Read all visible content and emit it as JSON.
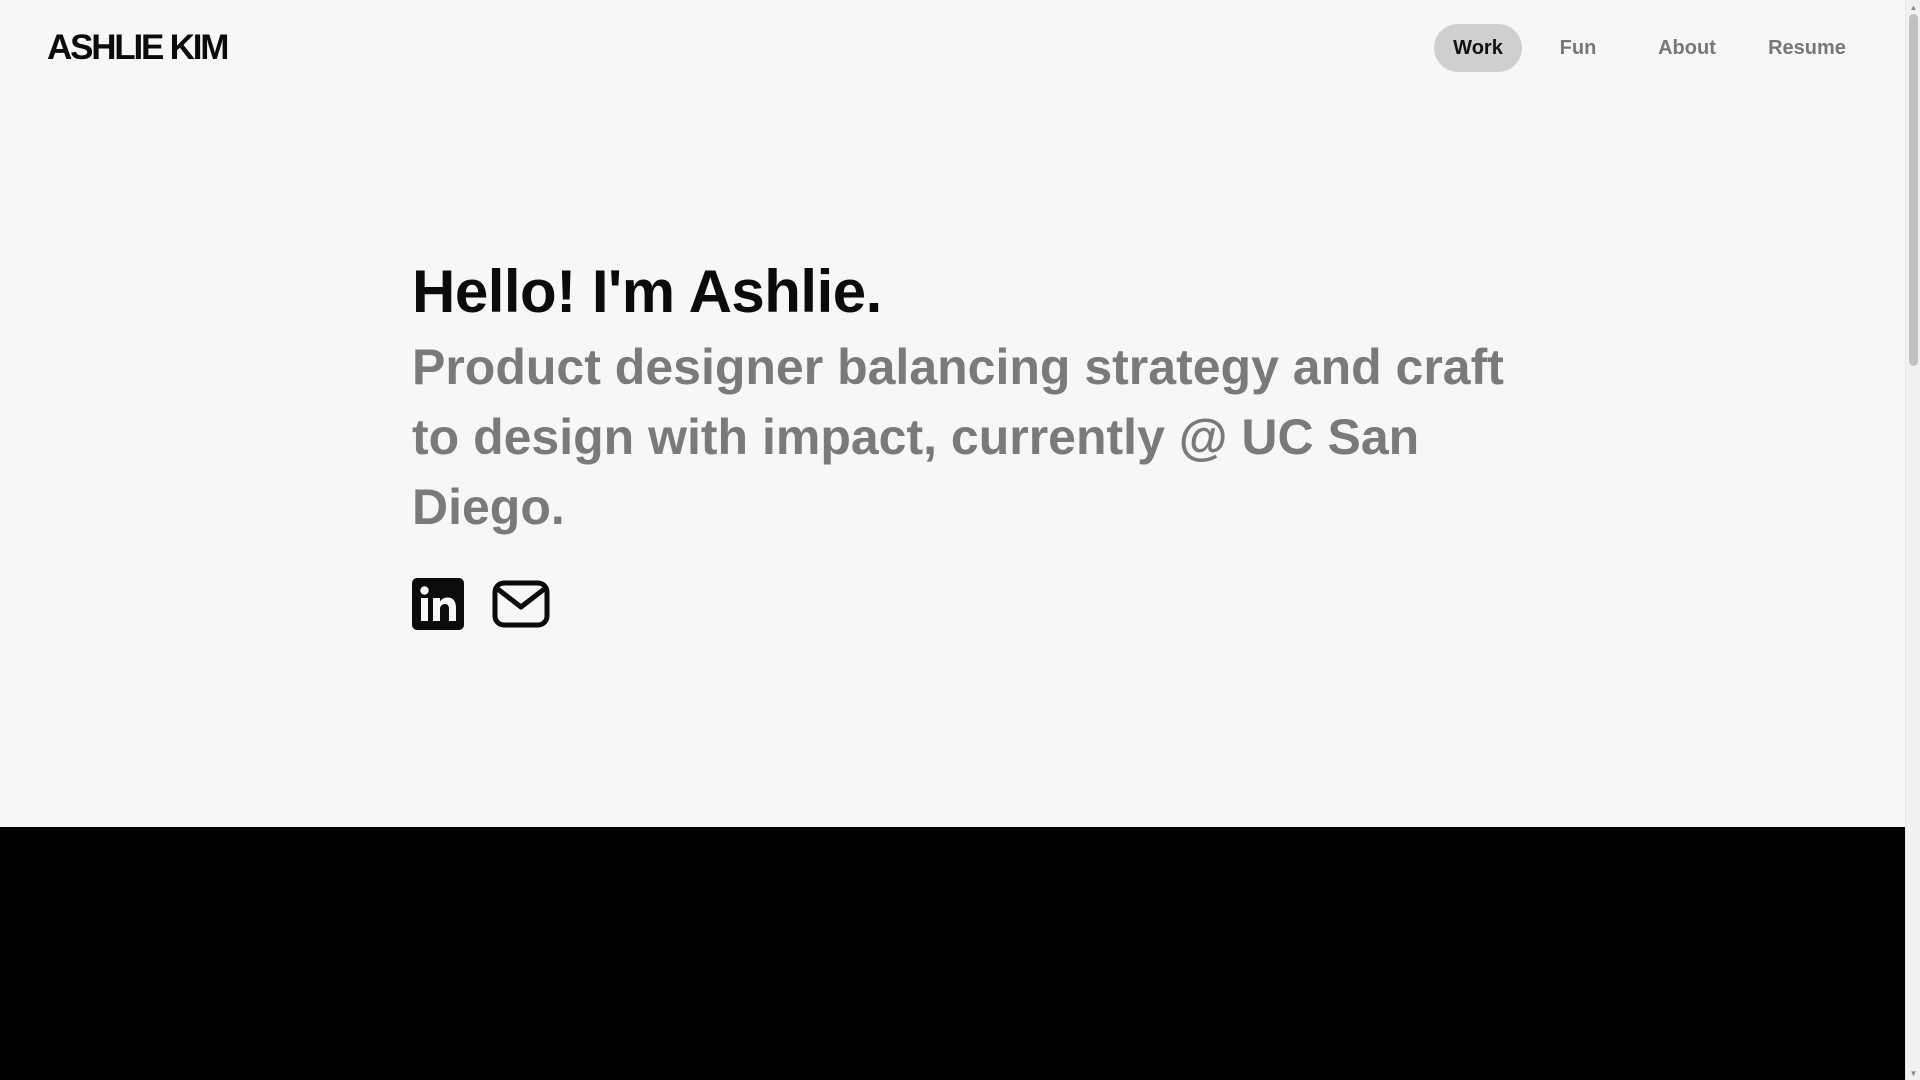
{
  "header": {
    "logo": "ASHLIE KIM",
    "nav": [
      {
        "label": "Work",
        "active": true
      },
      {
        "label": "Fun",
        "active": false
      },
      {
        "label": "About",
        "active": false
      },
      {
        "label": "Resume",
        "active": false
      }
    ]
  },
  "hero": {
    "title": "Hello! I'm Ashlie.",
    "subtitle": "Product designer balancing strategy and craft to design with impact, currently @ UC San Diego."
  },
  "socials": [
    {
      "icon": "linkedin-icon"
    },
    {
      "icon": "mail-icon"
    }
  ],
  "colors": {
    "background": "#f7f7f7",
    "text_primary": "#0b0b0b",
    "text_secondary": "#7a7a7a",
    "nav_active_bg": "#cfcfcf",
    "dark_band": "#000000"
  },
  "scrollbar": {
    "up_arrow": "▲",
    "down_arrow": "▼"
  }
}
